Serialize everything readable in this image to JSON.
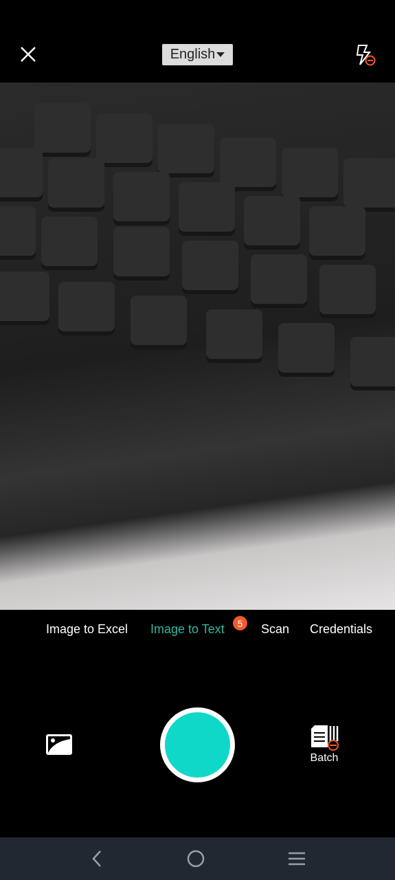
{
  "topbar": {
    "language": "English",
    "close_icon": "close-icon",
    "flash_icon": "flash-off-icon"
  },
  "modes": [
    {
      "label": "Image to Excel"
    },
    {
      "label": "Image to Text",
      "active": true,
      "badge": "5"
    },
    {
      "label": "Scan"
    },
    {
      "label": "Credentials"
    }
  ],
  "controls": {
    "batch_label": "Batch",
    "gallery_icon": "gallery-icon",
    "shutter_color": "#0fd8c8"
  },
  "colors": {
    "accent": "#2fb8a3",
    "badge": "#f05a2b"
  },
  "navbar": {
    "icons": [
      "back-icon",
      "home-icon",
      "menu-icon"
    ]
  }
}
